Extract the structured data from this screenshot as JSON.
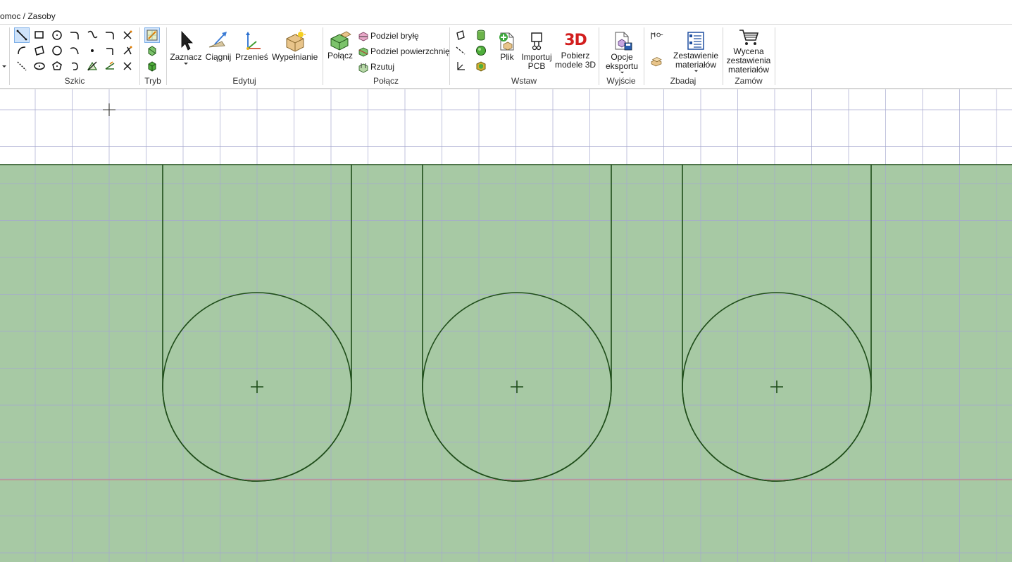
{
  "menubar": {
    "text": "omoc / Zasoby"
  },
  "ribbon": {
    "groups": {
      "szkic": {
        "label": "Szkic"
      },
      "tryb": {
        "label": "Tryb"
      },
      "edytuj": {
        "label": "Edytuj",
        "zaznacz": "Zaznacz",
        "ciagnij": "Ciągnij",
        "przenies": "Przenieś",
        "wypelnianie": "Wypełnianie"
      },
      "polacz": {
        "label": "Połącz",
        "polacz_button": "Połącz",
        "podziel_bryle": "Podziel bryłę",
        "podziel_powierzchnie": "Podziel powierzchnię",
        "rzutuj": "Rzutuj"
      },
      "wstaw": {
        "label": "Wstaw",
        "plik": "Plik",
        "importuj_pcb_1": "Importuj",
        "importuj_pcb_2": "PCB",
        "pobierz_1": "Pobierz",
        "pobierz_2": "modele 3D",
        "icon_3d_text": "3D"
      },
      "wyjscie": {
        "label": "Wyjście",
        "opcje_1": "Opcje",
        "opcje_2": "eksportu"
      },
      "zbadaj": {
        "label": "Zbadaj",
        "zest_1": "Zestawienie",
        "zest_2": "materiałów"
      },
      "zamow": {
        "label": "Zamów",
        "wycena_1": "Wycena",
        "wycena_2": "zestawienia",
        "wycena_3": "materiałów"
      }
    }
  },
  "colors": {
    "canvas_bg": "#ffffff",
    "fill_region": "#a7c9a4",
    "grid": "#a6a9cf",
    "sketch_stroke": "#1f4d1a",
    "axis_red": "#c97b7b"
  }
}
